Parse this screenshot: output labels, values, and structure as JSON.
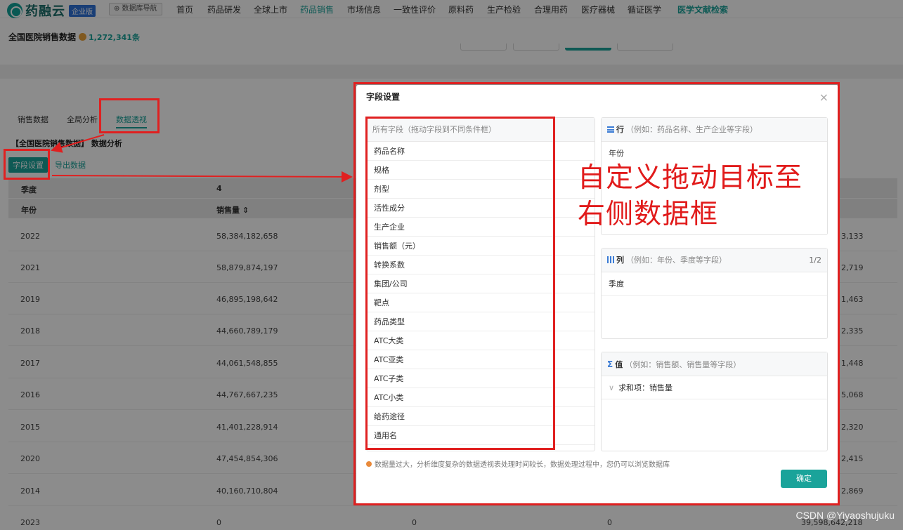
{
  "app": {
    "logo_text": "药融云",
    "edition": "企业版",
    "db_nav": "⊕ 数据库导航"
  },
  "nav": {
    "items": [
      "首页",
      "药品研发",
      "全球上市",
      "药品销售",
      "市场信息",
      "一致性评价",
      "原料药",
      "生产检验",
      "合理用药",
      "医疗器械",
      "循证医学",
      "医学文献检索"
    ]
  },
  "header": {
    "title": "全国医院销售数据",
    "count": "1,272,341条"
  },
  "tabs": [
    "销售数据",
    "全局分析",
    "数据透视"
  ],
  "crumb": "【全国医院销售数据】 数据分析",
  "toolbar": {
    "fields_label": "字段设置",
    "export_label": "导出数据"
  },
  "table": {
    "header1": {
      "col1": "季度",
      "col2": "4"
    },
    "header2": {
      "col1": "年份",
      "col2": "销售量 ⇕"
    },
    "rows": [
      {
        "year": "2022",
        "sales": "58,384,182,658",
        "tail": "3,133"
      },
      {
        "year": "2021",
        "sales": "58,879,874,197",
        "tail": "2,719"
      },
      {
        "year": "2019",
        "sales": "46,895,198,642",
        "tail": "1,463"
      },
      {
        "year": "2018",
        "sales": "44,660,789,179",
        "tail": "2,335"
      },
      {
        "year": "2017",
        "sales": "44,061,548,855",
        "tail": "1,448"
      },
      {
        "year": "2016",
        "sales": "44,767,667,235",
        "tail": "5,068"
      },
      {
        "year": "2015",
        "sales": "41,401,228,914",
        "tail": "2,320"
      },
      {
        "year": "2020",
        "sales": "47,454,854,306",
        "tail": "2,415"
      },
      {
        "year": "2014",
        "sales": "40,160,710,804",
        "tail": "2,869"
      },
      {
        "year": "2023",
        "sales": "0",
        "c3": "0",
        "c4": "0",
        "tail": "39,598,642,218"
      }
    ]
  },
  "modal": {
    "title": "字段设置",
    "close": "×",
    "all_fields_head": "所有字段（拖动字段到不同条件框）",
    "fields": [
      "药品名称",
      "规格",
      "剂型",
      "活性成分",
      "生产企业",
      "销售额（元）",
      "转换系数",
      "集团/公司",
      "靶点",
      "药品类型",
      "ATC大类",
      "ATC亚类",
      "ATC子类",
      "ATC小类",
      "给药途径",
      "通用名"
    ],
    "rows_panel": {
      "label": "行",
      "hint": "（例如：药品名称、生产企业等字段）",
      "items": [
        "年份"
      ]
    },
    "cols_panel": {
      "label": "列",
      "hint": "（例如：年份、季度等字段）",
      "ratio": "1/2",
      "items": [
        "季度"
      ]
    },
    "values_panel": {
      "label": "值",
      "hint": "（例如：销售额、销售量等字段）",
      "items": [
        "求和项：销售量"
      ],
      "item_prefix": "∨"
    },
    "note": "数据量过大，分析维度复杂的数据透视表处理时间较长，数据处理过程中，您仍可以浏览数据库",
    "confirm": "确定"
  },
  "annotation": {
    "line1": "自定义拖动目标至",
    "line2": "右侧数据框"
  },
  "watermark": "CSDN @Yiyaoshujuku",
  "colors": {
    "accent": "#1aa39a",
    "annotation": "#e11b1b",
    "edition": "#2f71d8"
  }
}
